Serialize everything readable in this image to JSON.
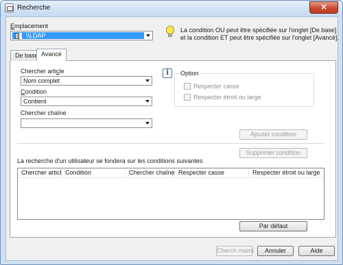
{
  "window": {
    "title": "Recherche",
    "close_glyph": "×"
  },
  "emplacement": {
    "label_first": "E",
    "label_rest": "mplacement",
    "value": "\\\\LDAP",
    "icon": "ldap-server-icon"
  },
  "hint": {
    "icon": "lightbulb-icon",
    "line1": "La condition OU peut être spécifiée sur l'onglet [De base]",
    "line2": "et la condition ET peut être spécifiée sur l'onglet [Avancé]."
  },
  "tabs": [
    {
      "label": "De base",
      "active": false
    },
    {
      "label": "Avancé",
      "active": true
    }
  ],
  "form": {
    "chercher_article": {
      "label_pre": "Chercher arti",
      "label_u": "c",
      "label_post": "le",
      "value": "Nom complet"
    },
    "condition": {
      "label_pre": "",
      "label_u": "C",
      "label_post": "ondition",
      "value": "Contient"
    },
    "chercher_chaine": {
      "label": "Chercher chaîne",
      "value": ""
    }
  },
  "option": {
    "icon": "info-icon",
    "info_glyph": "i",
    "title": "Option",
    "respecter_casse": {
      "label": "Respecter casse",
      "checked": false
    },
    "respecter_etroit_large": {
      "label": "Respecter étroit ou large",
      "checked": false
    }
  },
  "buttons": {
    "ajouter_condition": "Ajouter condition",
    "supprimer_condition": "Supprimer condition",
    "par_defaut": "Par défaut",
    "cherch_maint": "Cherch maint",
    "annuler": "Annuler",
    "aide": "Aide"
  },
  "conditions_list": {
    "caption": "La recherche d'un utilisateur se fondera sur les conditions suivantes",
    "columns": [
      "Chercher article",
      "Condition",
      "Chercher chaîne",
      "Respecter casse",
      "Respecter étroit ou large"
    ],
    "rows": []
  }
}
